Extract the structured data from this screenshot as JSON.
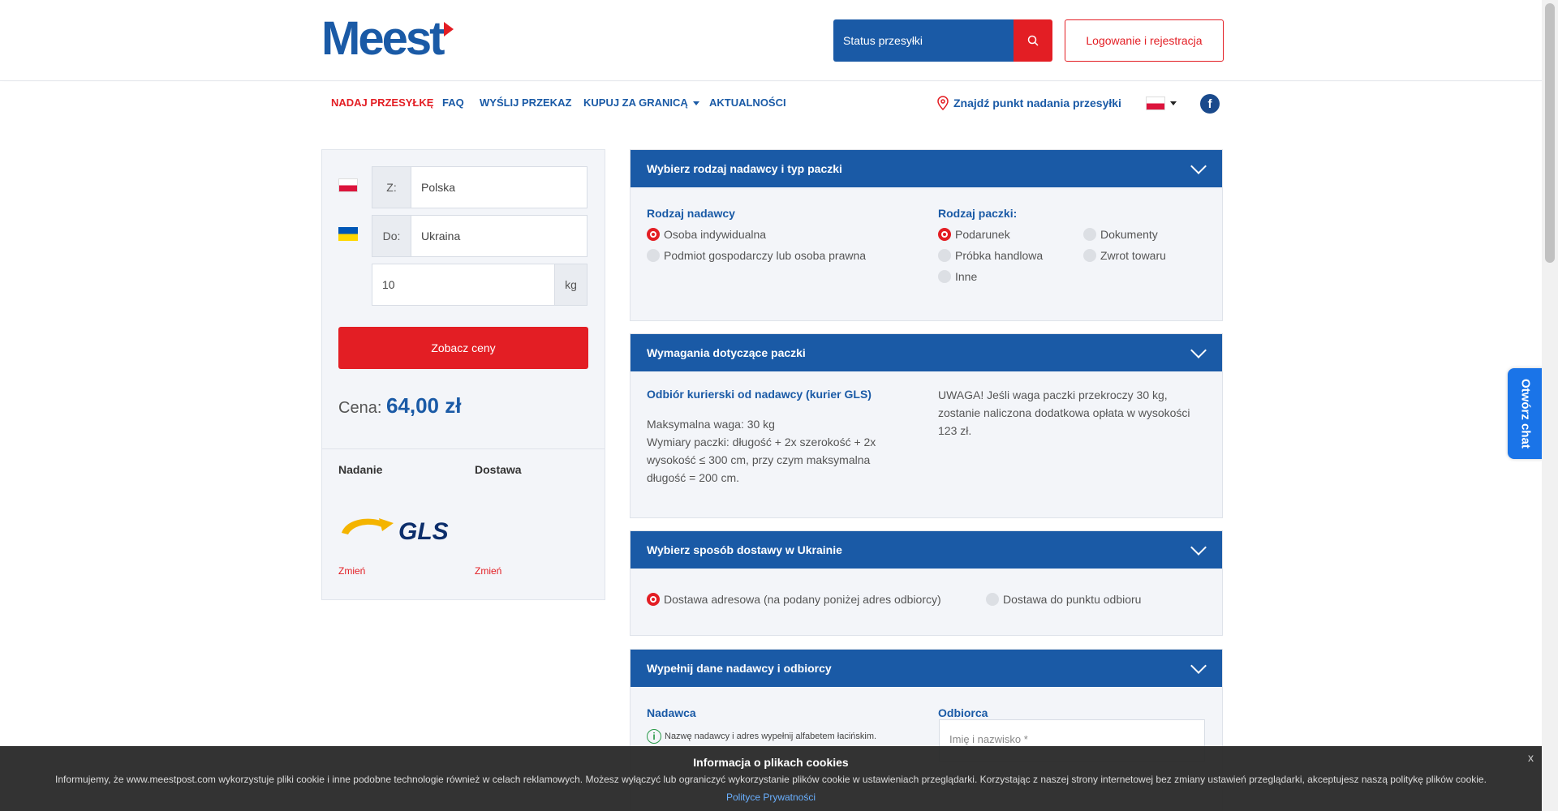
{
  "header": {
    "logo_text": "Meest",
    "status_placeholder": "Status przesyłki",
    "login_label": "Logowanie i rejestracja"
  },
  "nav": {
    "items": [
      {
        "label": "NADAJ PRZESYŁKĘ"
      },
      {
        "label": "FAQ"
      },
      {
        "label": "WYŚLIJ PRZEKAZ"
      },
      {
        "label": "KUPUJ ZA GRANICĄ"
      },
      {
        "label": "AKTUALNOŚCI"
      }
    ],
    "find_point": "Znajdź punkt nadania przesyłki",
    "facebook": "f"
  },
  "calculator": {
    "from_prefix": "Z:",
    "from_value": "Polska",
    "to_prefix": "Do:",
    "to_value": "Ukraina",
    "weight_value": "10",
    "weight_unit": "kg",
    "button": "Zobacz ceny",
    "price_label": "Cena:",
    "price_value": "64,00 zł",
    "sending_label": "Nadanie",
    "delivery_label": "Dostawa",
    "carrier": "GLS",
    "change_1": "Zmień",
    "change_2": "Zmień"
  },
  "section1": {
    "title": "Wybierz rodzaj nadawcy i typ paczki",
    "sender_type_title": "Rodzaj nadawcy",
    "sender_options": [
      "Osoba indywidualna",
      "Podmiot gospodarczy lub osoba prawna"
    ],
    "package_type_title": "Rodzaj paczki:",
    "package_options": [
      "Podarunek",
      "Dokumenty",
      "Próbka handlowa",
      "Zwrot towaru",
      "Inne"
    ]
  },
  "section2": {
    "title": "Wymagania dotyczące paczki",
    "courier_title": "Odbiór kurierski od nadawcy (kurier GLS)",
    "max_weight": "Maksymalna waga: 30 kg",
    "dimensions": "Wymiary paczki: długość + 2x szerokość + 2x wysokość ≤ 300 cm, przy czym maksymalna długość = 200 cm.",
    "warning": "UWAGA! Jeśli waga paczki przekroczy 30 kg, zostanie naliczona dodatkowa opłata w wysokości 123 zł."
  },
  "section3": {
    "title": "Wybierz sposób dostawy w Ukrainie",
    "options": [
      "Dostawa adresowa (na podany poniżej adres odbiorcy)",
      "Dostawa do punktu odbioru"
    ]
  },
  "section4": {
    "title": "Wypełnij dane nadawcy i odbiorcy",
    "sender_title": "Nadawca",
    "sender_note": "Nazwę nadawcy i adres wypełnij alfabetem łacińskim.",
    "recipient_title": "Odbiorca",
    "recipient_placeholder": "Imię i nazwisko *"
  },
  "chat": {
    "label": "Otwórz chat"
  },
  "cookie": {
    "title": "Informacja o plikach cookies",
    "text": "Informujemy, że www.meestpost.com wykorzystuje pliki cookie i inne podobne technologie również w celach reklamowych. Możesz wyłączyć lub ograniczyć wykorzystanie plików cookie w ustawieniach przeglądarki. Korzystając z naszej strony internetowej bez zmiany ustawień przeglądarki, akceptujesz naszą politykę plików cookie.",
    "link": "Polityce Prywatności",
    "close": "x"
  },
  "colors": {
    "brand_blue": "#1a5aa6",
    "accent_red": "#e31e24"
  }
}
